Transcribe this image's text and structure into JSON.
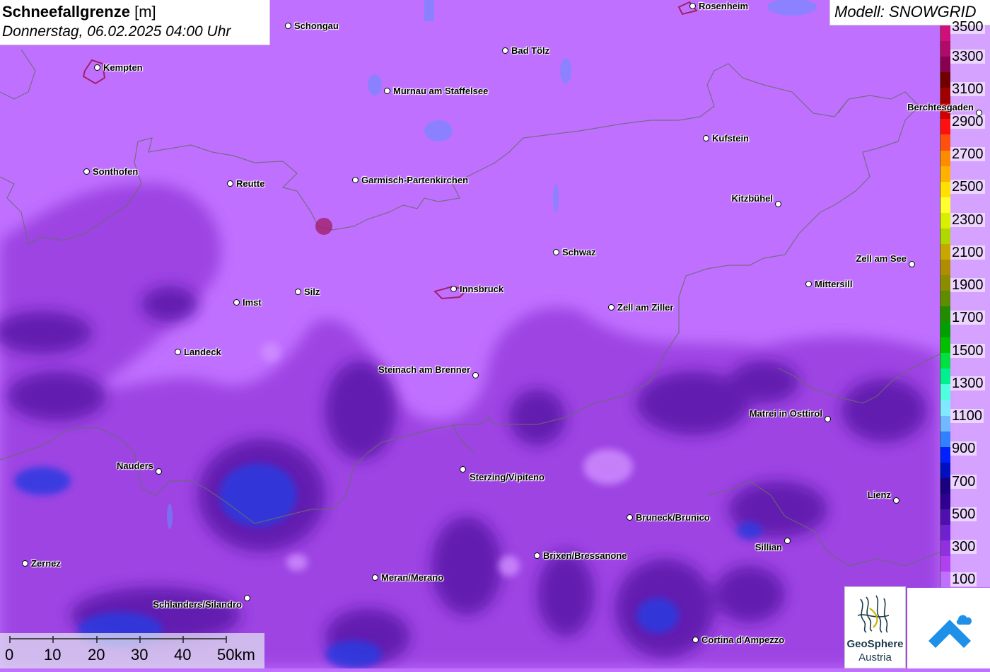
{
  "title": {
    "param": "Schneefallgrenze",
    "unit": "[m]",
    "datetime": "Donnerstag, 06.02.2025 04:00 Uhr"
  },
  "model": "Modell: SNOWGRID",
  "legend": {
    "labels": [
      "3500",
      "3300",
      "3100",
      "2900",
      "2700",
      "2500",
      "2300",
      "2100",
      "1900",
      "1700",
      "1500",
      "1300",
      "1100",
      "900",
      "700",
      "500",
      "300",
      "100"
    ],
    "colors": [
      "#d0107a",
      "#b00a6a",
      "#8a0050",
      "#700000",
      "#a00000",
      "#d00000",
      "#ff1010",
      "#ff5010",
      "#ff8c00",
      "#ffb000",
      "#ffe000",
      "#ffff30",
      "#d8f000",
      "#b0d800",
      "#c8a800",
      "#b08c00",
      "#8c8c00",
      "#608c00",
      "#208c00",
      "#00a000",
      "#00c000",
      "#00e040",
      "#00f090",
      "#50ffe0",
      "#80e8ff",
      "#70b8ff",
      "#3080ff",
      "#0020ff",
      "#0010c0",
      "#1a0080",
      "#300090",
      "#5010b0",
      "#7020d0",
      "#9030e0",
      "#b040f0",
      "#c070ff"
    ]
  },
  "scale": {
    "labels": [
      "0",
      "10",
      "20",
      "30",
      "40",
      "50km"
    ]
  },
  "cities": [
    {
      "name": "Rosenheim"
    },
    {
      "name": "Schongau"
    },
    {
      "name": "Kempten"
    },
    {
      "name": "Bad Tölz"
    },
    {
      "name": "Murnau am Staffelsee"
    },
    {
      "name": "Berchtesgaden"
    },
    {
      "name": "Kufstein"
    },
    {
      "name": "Sonthofen"
    },
    {
      "name": "Reutte"
    },
    {
      "name": "Garmisch-Partenkirchen"
    },
    {
      "name": "Kitzbühel"
    },
    {
      "name": "Schwaz"
    },
    {
      "name": "Zell am See"
    },
    {
      "name": "Mittersill"
    },
    {
      "name": "Imst"
    },
    {
      "name": "Silz"
    },
    {
      "name": "Innsbruck"
    },
    {
      "name": "Zell am Ziller"
    },
    {
      "name": "Landeck"
    },
    {
      "name": "Steinach am Brenner"
    },
    {
      "name": "Matrei in Osttirol"
    },
    {
      "name": "Nauders"
    },
    {
      "name": "Sterzing/Vipiteno"
    },
    {
      "name": "Lienz"
    },
    {
      "name": "Bruneck/Brunico"
    },
    {
      "name": "Sillian"
    },
    {
      "name": "Brixen/Bressanone"
    },
    {
      "name": "Zernez"
    },
    {
      "name": "Meran/Merano"
    },
    {
      "name": "Schlanders/Silandro"
    },
    {
      "name": "Cortina d'Ampezzo"
    }
  ],
  "logos": {
    "geosphere_line1": "GeoSphere",
    "geosphere_line2": "Austria"
  }
}
